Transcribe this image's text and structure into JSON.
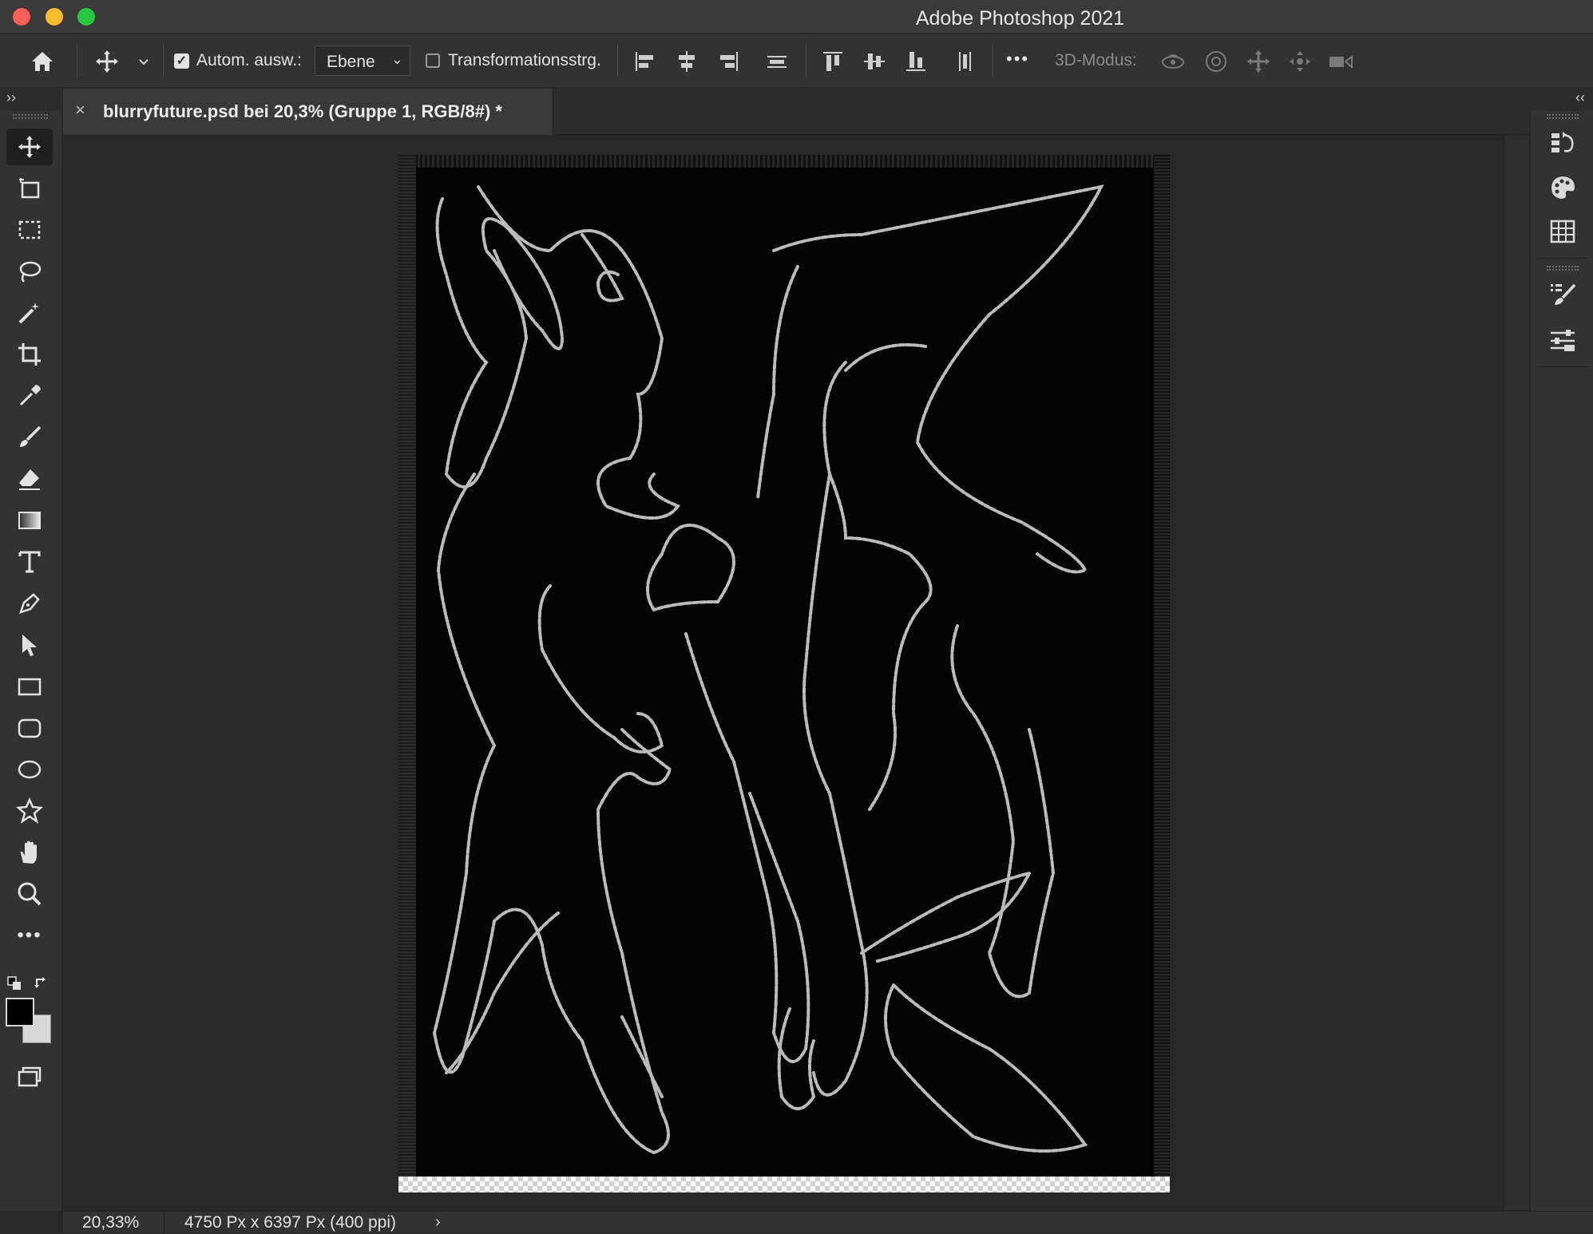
{
  "window": {
    "title": "Adobe Photoshop 2021"
  },
  "options_bar": {
    "auto_select_label": "Autom. ausw.:",
    "auto_select_checked": true,
    "auto_select_target": "Ebene",
    "transform_controls_label": "Transformationsstrg.",
    "transform_controls_checked": false,
    "more_label": "•••",
    "mode_3d_label": "3D-Modus:"
  },
  "document_tab": {
    "close_label": "×",
    "title": "blurryfuture.psd bei 20,3% (Gruppe 1, RGB/8#) *"
  },
  "toolbar": {
    "collapse_label": "››",
    "more_tools_label": "•••",
    "foreground_color": "#000000",
    "background_color": "#d9d9d9"
  },
  "right_panel": {
    "collapse_label": "‹‹"
  },
  "status_bar": {
    "zoom": "20,33%",
    "document_info": "4750 Px x 6397 Px (400 ppi)",
    "arrow_label": "›"
  }
}
